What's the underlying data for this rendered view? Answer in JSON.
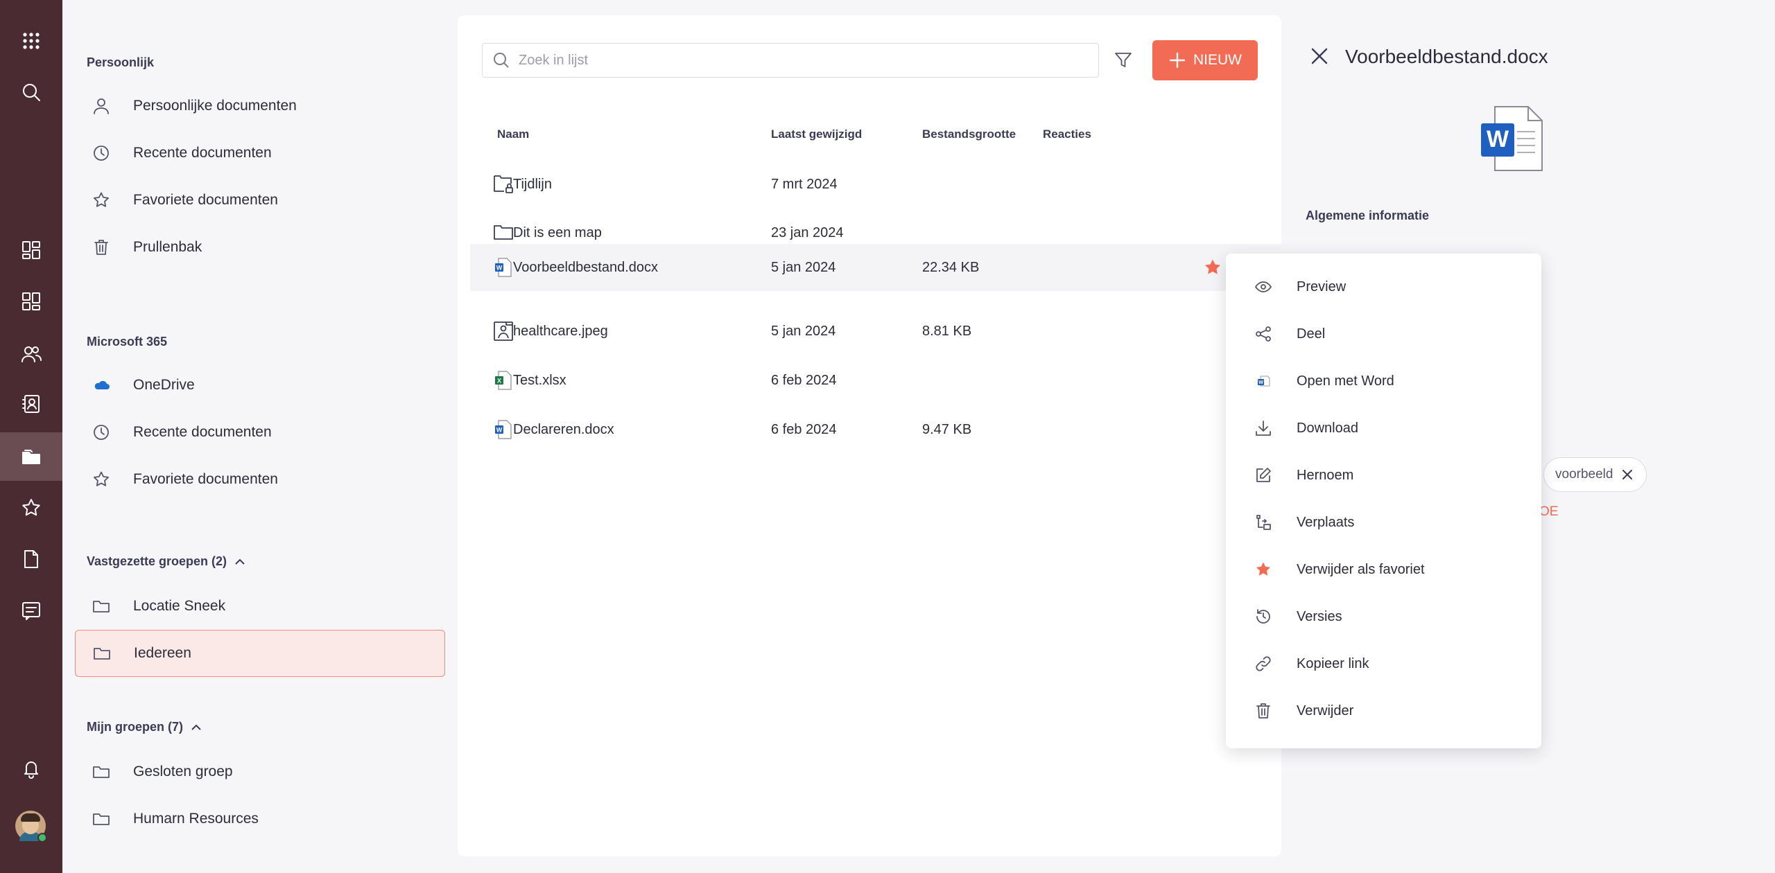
{
  "colors": {
    "accent": "#f26b55",
    "rail": "#4a2b32",
    "selected_bg": "#fbe9e7",
    "star": "#f26b55"
  },
  "rail": {
    "icons": [
      "apps-grid-icon",
      "search-icon",
      "dashboard-icon",
      "dashboard-alt-icon",
      "people-icon",
      "contacts-icon",
      "folder-icon",
      "star-icon",
      "document-icon",
      "message-icon",
      "bell-icon"
    ]
  },
  "nav": {
    "personal": {
      "title": "Persoonlijk",
      "items": [
        {
          "label": "Persoonlijke documenten",
          "icon": "user-icon"
        },
        {
          "label": "Recente documenten",
          "icon": "clock-icon"
        },
        {
          "label": "Favoriete documenten",
          "icon": "star-icon"
        },
        {
          "label": "Prullenbak",
          "icon": "trash-icon"
        }
      ]
    },
    "microsoft": {
      "title": "Microsoft 365",
      "items": [
        {
          "label": "OneDrive",
          "icon": "onedrive-icon"
        },
        {
          "label": "Recente documenten",
          "icon": "clock-icon"
        },
        {
          "label": "Favoriete documenten",
          "icon": "star-icon"
        }
      ]
    },
    "pinned": {
      "title": "Vastgezette groepen (2)",
      "items": [
        {
          "label": "Locatie Sneek",
          "icon": "folder-icon"
        },
        {
          "label": "Iedereen",
          "icon": "folder-icon"
        }
      ]
    },
    "mygroups": {
      "title": "Mijn groepen (7)",
      "items": [
        {
          "label": "Gesloten groep",
          "icon": "folder-icon"
        },
        {
          "label": "Humarn Resources",
          "icon": "folder-icon"
        }
      ]
    }
  },
  "toolbar": {
    "search_placeholder": "Zoek in lijst",
    "new_label": "NIEUW"
  },
  "table": {
    "headers": {
      "name": "Naam",
      "modified": "Laatst gewijzigd",
      "size": "Bestandsgrootte",
      "reactions": "Reacties"
    },
    "rows": [
      {
        "name": "Tijdlijn",
        "modified": "7 mrt 2024",
        "size": "",
        "icon": "locked-folder-icon"
      },
      {
        "name": "Dit is een map",
        "modified": "23 jan 2024",
        "size": "",
        "icon": "folder-icon"
      },
      {
        "name": "Voorbeeldbestand.docx",
        "modified": "5 jan 2024",
        "size": "22.34 KB",
        "icon": "word-file-icon",
        "favorite": true
      },
      {
        "name": "healthcare.jpeg",
        "modified": "5 jan 2024",
        "size": "8.81 KB",
        "icon": "image-file-icon"
      },
      {
        "name": "Test.xlsx",
        "modified": "6 feb 2024",
        "size": "",
        "icon": "excel-file-icon"
      },
      {
        "name": "Declareren.docx",
        "modified": "6 feb 2024",
        "size": "9.47 KB",
        "icon": "word-file-icon"
      }
    ]
  },
  "detail": {
    "title": "Voorbeeldbestand.docx",
    "section": "Algemene informatie",
    "tag": "voorbeeld",
    "add_partial": "OE"
  },
  "context_menu": [
    {
      "label": "Preview",
      "icon": "eye-icon"
    },
    {
      "label": "Deel",
      "icon": "share-icon"
    },
    {
      "label": "Open met Word",
      "icon": "word-icon"
    },
    {
      "label": "Download",
      "icon": "download-icon"
    },
    {
      "label": "Hernoem",
      "icon": "edit-icon"
    },
    {
      "label": "Verplaats",
      "icon": "move-icon"
    },
    {
      "label": "Verwijder als favoriet",
      "icon": "star-filled-icon"
    },
    {
      "label": "Versies",
      "icon": "history-icon"
    },
    {
      "label": "Kopieer link",
      "icon": "link-icon"
    },
    {
      "label": "Verwijder",
      "icon": "trash-icon"
    }
  ]
}
